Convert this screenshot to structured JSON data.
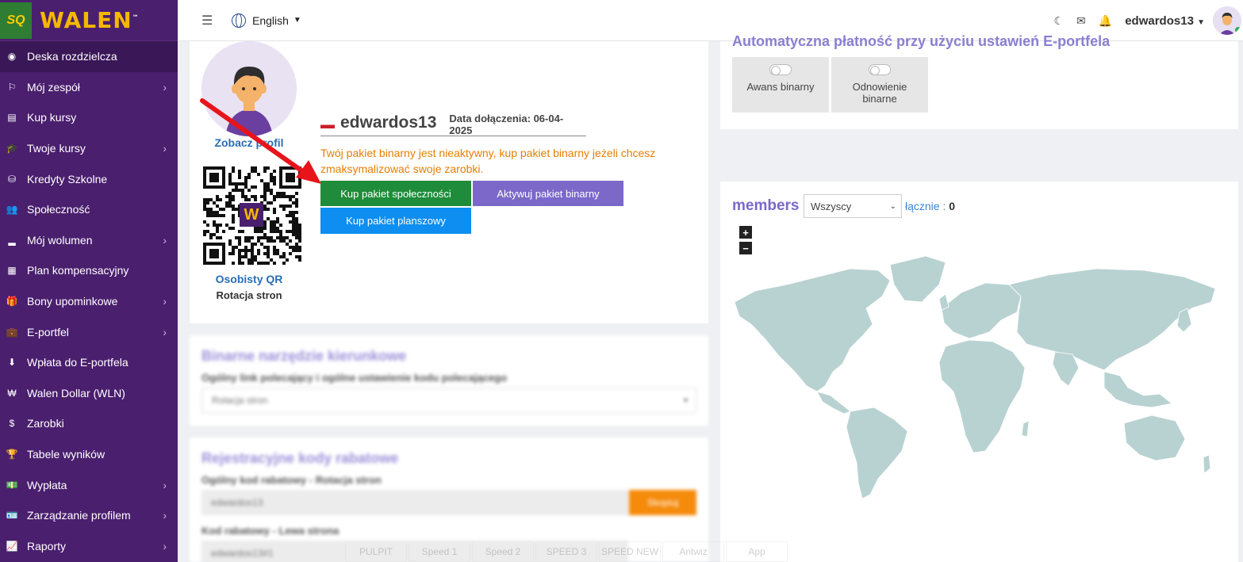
{
  "brand": {
    "logo_text": "SQ",
    "name": "WALEN"
  },
  "sidebar": {
    "items": [
      {
        "label": "Deska rozdzielcza",
        "icon": "gauge-icon",
        "glyph": "◉",
        "arrow": false,
        "active": true
      },
      {
        "label": "Mój zespół",
        "icon": "sitemap-icon",
        "glyph": "⚐",
        "arrow": true
      },
      {
        "label": "Kup kursy",
        "icon": "book-icon",
        "glyph": "▤",
        "arrow": false
      },
      {
        "label": "Twoje kursy",
        "icon": "graduation-cap-icon",
        "glyph": "🎓",
        "arrow": true
      },
      {
        "label": "Kredyty Szkolne",
        "icon": "coins-icon",
        "glyph": "⛁",
        "arrow": false
      },
      {
        "label": "Społeczność",
        "icon": "users-icon",
        "glyph": "👥",
        "arrow": false
      },
      {
        "label": "Mój wolumen",
        "icon": "signal-icon",
        "glyph": "▂",
        "arrow": true
      },
      {
        "label": "Plan kompensacyjny",
        "icon": "calculator-icon",
        "glyph": "▦",
        "arrow": false
      },
      {
        "label": "Bony upominkowe",
        "icon": "gift-icon",
        "glyph": "🎁",
        "arrow": true
      },
      {
        "label": "E-portfel",
        "icon": "briefcase-icon",
        "glyph": "💼",
        "arrow": true
      },
      {
        "label": "Wpłata do E-portfela",
        "icon": "download-circle-icon",
        "glyph": "⬇",
        "arrow": false
      },
      {
        "label": "Walen Dollar (WLN)",
        "icon": "won-sign-icon",
        "glyph": "₩",
        "arrow": false
      },
      {
        "label": "Zarobki",
        "icon": "dollar-icon",
        "glyph": "$",
        "arrow": false
      },
      {
        "label": "Tabele wyników",
        "icon": "trophy-icon",
        "glyph": "🏆",
        "arrow": false
      },
      {
        "label": "Wypłata",
        "icon": "money-bill-icon",
        "glyph": "💵",
        "arrow": true
      },
      {
        "label": "Zarządzanie profilem",
        "icon": "id-card-icon",
        "glyph": "🪪",
        "arrow": true
      },
      {
        "label": "Raporty",
        "icon": "chart-line-icon",
        "glyph": "📈",
        "arrow": true
      }
    ]
  },
  "topbar": {
    "language": "English",
    "username": "edwardos13"
  },
  "profile": {
    "view_profile": "Zobacz profil",
    "qr_label": "Osobisty QR",
    "qr_sub": "Rotacja stron",
    "qr_logo": "W",
    "username": "edwardos13",
    "join_date": "Data dołączenia: 06-04-2025",
    "warning": "Twój pakiet binarny jest nieaktywny, kup pakiet binarny jeżeli chcesz zmaksymalizować swoje zarobki.",
    "btn_community": "Kup pakiet społeczności",
    "btn_binary": "Aktywuj pakiet binarny",
    "btn_board": "Kup pakiet planszowy"
  },
  "binary_tool": {
    "title": "Binarne narzędzie kierunkowe",
    "subtitle": "Ogólny link polecający i ogólne ustawienie kodu polecającego",
    "select_value": "Rotacja stron"
  },
  "rebate": {
    "title": "Rejestracyjne kody rabatowe",
    "general_label": "Ogólny kod rabatowy - Rotacja stron",
    "general_value": "edwardos13",
    "copy_label": "Skopiuj",
    "left_label": "Kod rabatowy - Lewa strona",
    "left_value": "edwardos13#1"
  },
  "auto_payment": {
    "title": "Automatyczna płatność przy użyciu ustawień E-portfela",
    "toggle1": "Awans binarny",
    "toggle2": "Odnowienie binarne"
  },
  "members": {
    "label": "members",
    "select_value": "Wszyscy",
    "total_label": "łącznie :",
    "total_value": "0",
    "zoom_in": "+",
    "zoom_out": "−"
  },
  "bottom_bar": [
    "PULPIT",
    "Speed 1",
    "Speed 2",
    "SPEED 3",
    "SPEED NEW",
    "Antwiz",
    "App"
  ]
}
